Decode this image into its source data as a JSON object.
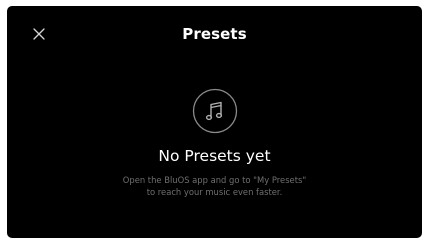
{
  "header": {
    "title": "Presets",
    "close_icon": "close-icon"
  },
  "empty_state": {
    "icon": "music-note-icon",
    "heading": "No Presets yet",
    "description_line1": "Open the BluOS app and go to \"My Presets\"",
    "description_line2": "to reach your music even faster."
  },
  "colors": {
    "background": "#000000",
    "text_primary": "#ffffff",
    "text_secondary": "#6f6f6f",
    "icon_stroke": "#8a8a8a"
  }
}
